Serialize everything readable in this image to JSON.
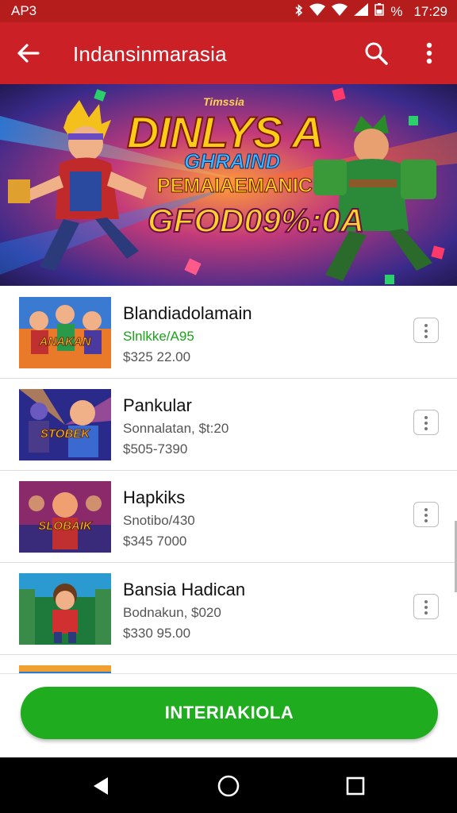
{
  "status_bar": {
    "left_text": "AP3",
    "battery_text": "%",
    "time": "17:29"
  },
  "app_bar": {
    "title": "Indansinmarasia"
  },
  "banner": {
    "small_text": "Timssia",
    "title": "DINLYS A",
    "subtitle1": "GHRAIND",
    "subtitle2": "PEMAIAEMANIC",
    "price_text": "GFOD09%:0A"
  },
  "items": [
    {
      "title": "Blandiadolamain",
      "subtitle": "Slnlkke/A95",
      "subtitle_color": "#1aa31a",
      "price": "$325 22.00",
      "thumb_label": "ANAKAN"
    },
    {
      "title": "Pankular",
      "subtitle": "Sonnalatan, $t:20",
      "subtitle_color": "#555555",
      "price": "$505-7390",
      "thumb_label": "STOBEK"
    },
    {
      "title": "Hapkiks",
      "subtitle": "Snotibo/430",
      "subtitle_color": "#555555",
      "price": "$345 7000",
      "thumb_label": "SLOBAIK"
    },
    {
      "title": "Bansia Hadican",
      "subtitle": "Bodnakun, $020",
      "subtitle_color": "#555555",
      "price": "$330 95.00",
      "thumb_label": ""
    }
  ],
  "cta": {
    "label": "INTERIAKIOLA"
  },
  "colors": {
    "app_bar": "#cc2027",
    "status_bar": "#b51c1c",
    "cta": "#1fac1f"
  }
}
